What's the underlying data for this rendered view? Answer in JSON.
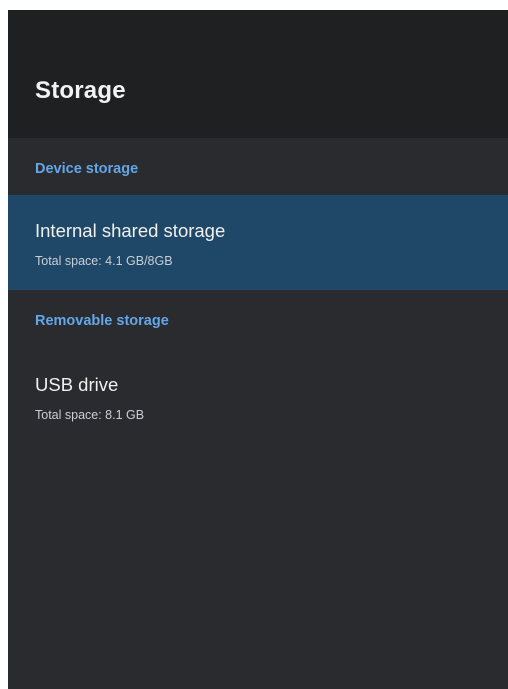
{
  "header": {
    "title": "Storage"
  },
  "sections": [
    {
      "header": "Device storage",
      "items": [
        {
          "title": "Internal shared storage",
          "subtitle": "Total space: 4.1 GB/8GB",
          "selected": true
        }
      ]
    },
    {
      "header": "Removable storage",
      "items": [
        {
          "title": "USB drive",
          "subtitle": "Total space: 8.1 GB",
          "selected": false
        }
      ]
    }
  ],
  "colors": {
    "background": "#2a2b2e",
    "header_background": "#1f2022",
    "selected_row": "#1f4868",
    "section_header": "#64a6e8",
    "primary_text": "#f0f0f0",
    "secondary_text": "#c9ced4"
  }
}
